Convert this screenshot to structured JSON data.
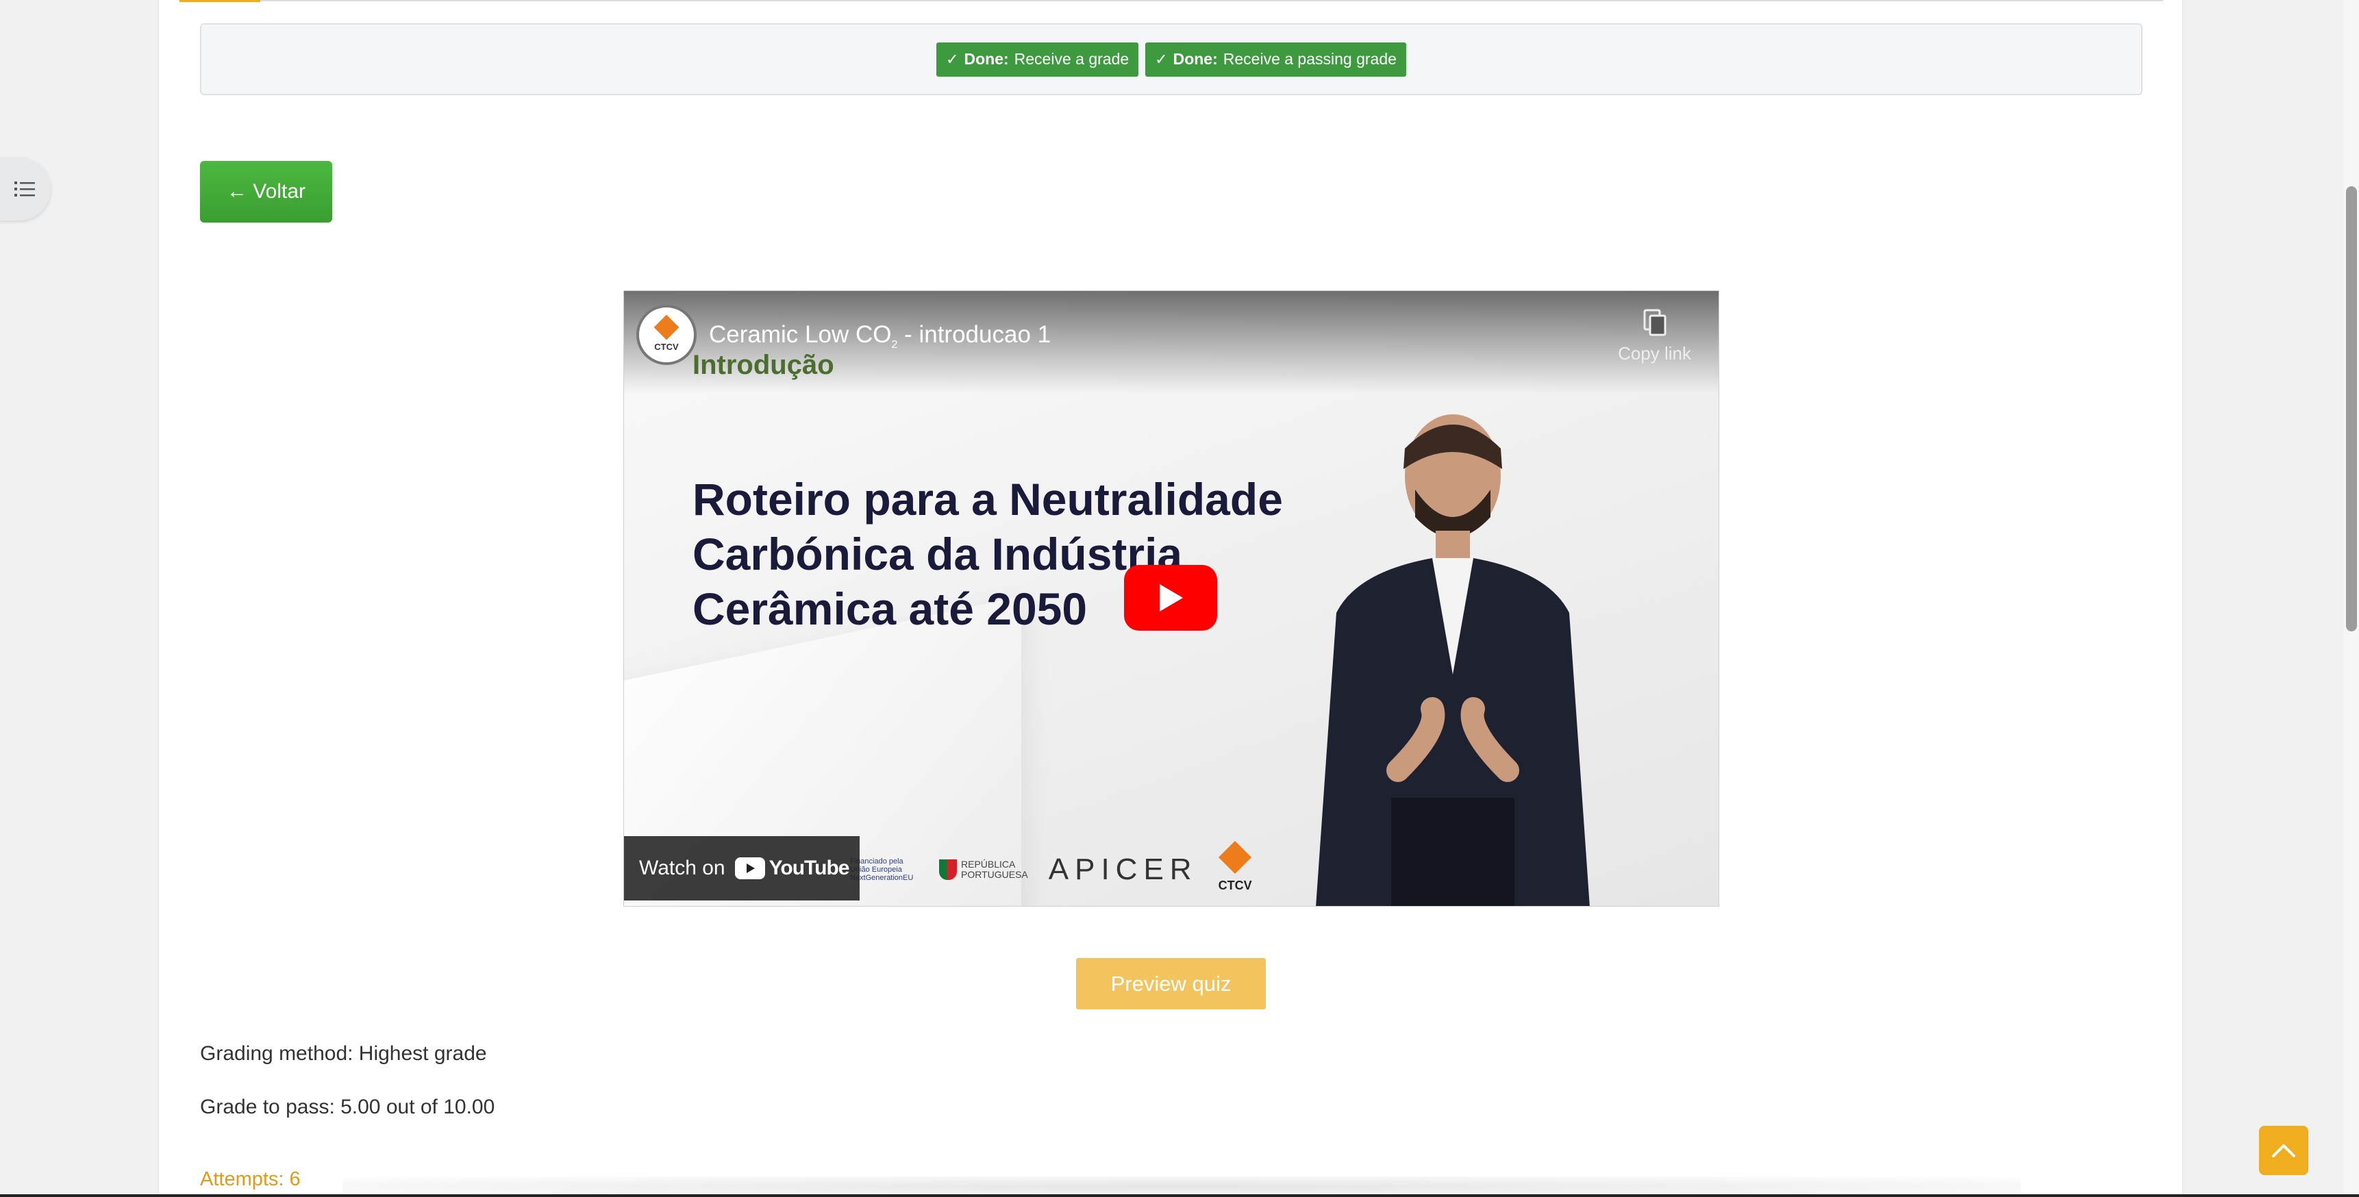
{
  "completion": {
    "badges": [
      {
        "status": "Done:",
        "text": "Receive a grade"
      },
      {
        "status": "Done:",
        "text": "Receive a passing grade"
      }
    ]
  },
  "navigation": {
    "back_label": "← Voltar",
    "index_icon": "list-icon"
  },
  "video": {
    "title_main": "Ceramic Low CO",
    "title_sub": "2",
    "title_rest": " - introducao 1",
    "channel_logo_label": "CTCV",
    "copy_link_label": "Copy link",
    "section_label": "Introdução",
    "headline": [
      "Roteiro para a Neutralidade",
      "Carbónica da Indústria",
      "Cerâmica até 2050"
    ],
    "watch_on_label": "Watch on",
    "youtube_label": "YouTube",
    "sponsors": {
      "eu_text": "Financiado pela União Europeia NextGenerationEU",
      "republica_line1": "REPÚBLICA",
      "republica_line2": "PORTUGUESA",
      "apicer": "APICER",
      "ctcv": "CTCV"
    }
  },
  "quiz": {
    "preview_label": "Preview quiz",
    "grading_method": "Grading method: Highest grade",
    "grade_to_pass": "Grade to pass: 5.00 out of 10.00",
    "attempts": "Attempts: 6"
  },
  "colors": {
    "done_badge": "#3d9a3f",
    "back_button": "#3fa535",
    "preview_button": "#f3c45d",
    "attempts_text": "#e39a16",
    "back_to_top": "#f0ad1e",
    "youtube_red": "#ff0000"
  },
  "icons": {
    "back_to_top": "chevron-up-icon",
    "play": "play-icon",
    "copy": "copy-icon",
    "check": "check-icon"
  }
}
